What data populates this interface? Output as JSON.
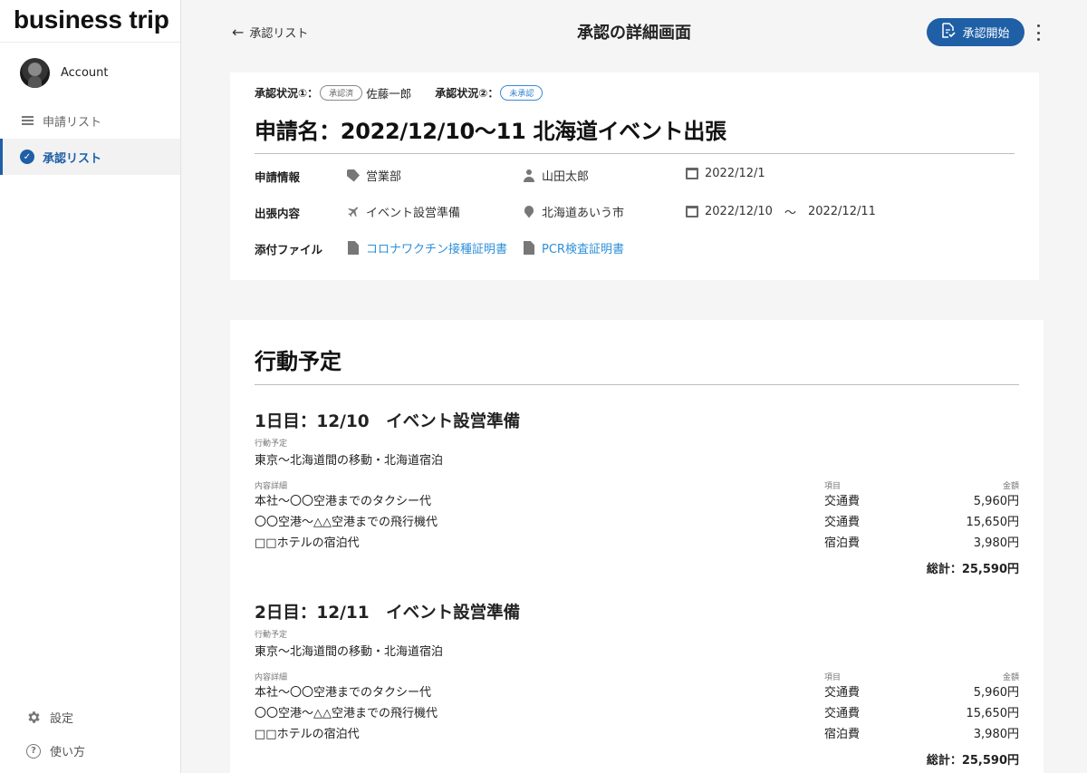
{
  "app": {
    "brand": "business trip"
  },
  "sidebar": {
    "account_label": "Account",
    "items": [
      {
        "label": "申請リスト",
        "icon": "list-icon",
        "active": false
      },
      {
        "label": "承認リスト",
        "icon": "check-circle-icon",
        "active": true
      }
    ],
    "bottom": [
      {
        "label": "設定",
        "icon": "gear-icon"
      },
      {
        "label": "使い方",
        "icon": "help-icon"
      }
    ]
  },
  "header": {
    "back_label": "承認リスト",
    "title": "承認の詳細画面",
    "start_button": "承認開始"
  },
  "summary": {
    "status1_label": "承認状況①：",
    "status1_badge": "承認済",
    "status1_person": "佐藤一郎",
    "status2_label": "承認状況②：",
    "status2_badge": "未承認",
    "application_title": "申請名：2022/12/10〜11 北海道イベント出張",
    "info_label": "申請情報",
    "department": "営業部",
    "applicant": "山田太郎",
    "applied_date": "2022/12/1",
    "trip_label": "出張内容",
    "purpose": "イベント設営準備",
    "destination": "北海道あいう市",
    "trip_start": "2022/12/10",
    "trip_separator": "〜",
    "trip_end": "2022/12/11",
    "attach_label": "添付ファイル",
    "attachments": [
      "コロナワクチン接種証明書",
      "PCR検査証明書"
    ]
  },
  "schedule": {
    "title": "行動予定",
    "plan_label": "行動予定",
    "detail_label": "内容詳細",
    "item_label": "項目",
    "amount_label": "金額",
    "days": [
      {
        "title": "1日目：12/10　イベント設営準備",
        "plan": "東京〜北海道間の移動・北海道宿泊",
        "rows": [
          {
            "desc": "本社〜〇〇空港までのタクシー代",
            "item": "交通費",
            "amount": "5,960円"
          },
          {
            "desc": "〇〇空港〜△△空港までの飛行機代",
            "item": "交通費",
            "amount": "15,650円"
          },
          {
            "desc": "□□ホテルの宿泊代",
            "item": "宿泊費",
            "amount": "3,980円"
          }
        ],
        "total": "総計：25,590円"
      },
      {
        "title": "2日目：12/11　イベント設営準備",
        "plan": "東京〜北海道間の移動・北海道宿泊",
        "rows": [
          {
            "desc": "本社〜〇〇空港までのタクシー代",
            "item": "交通費",
            "amount": "5,960円"
          },
          {
            "desc": "〇〇空港〜△△空港までの飛行機代",
            "item": "交通費",
            "amount": "15,650円"
          },
          {
            "desc": "□□ホテルの宿泊代",
            "item": "宿泊費",
            "amount": "3,980円"
          }
        ],
        "total": "総計：25,590円"
      }
    ]
  },
  "colors": {
    "primary": "#1f5fa6",
    "link": "#2f8fd8",
    "pending": "#2f7fd0"
  }
}
